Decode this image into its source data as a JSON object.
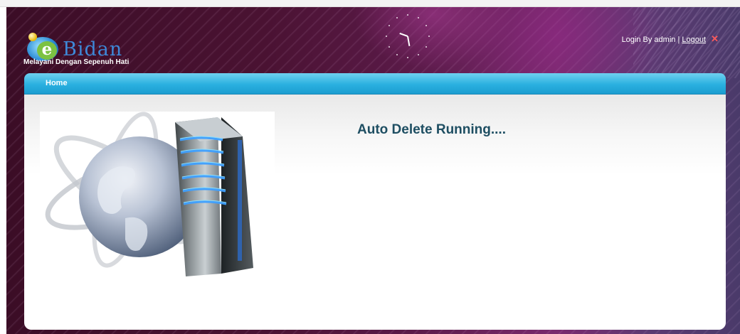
{
  "header": {
    "logo": {
      "letter": "e",
      "name": "Bidan",
      "tagline": "Melayani Dengan Sepenuh Hati"
    },
    "user": {
      "prefix": "Login By admin |",
      "logout_label": "Logout"
    },
    "icons": {
      "clock": "analog-clock-icon",
      "logout": "close-x-icon"
    }
  },
  "nav": {
    "items": [
      {
        "label": "Home"
      }
    ]
  },
  "main": {
    "status_text": "Auto Delete Running....",
    "illustration": "server-globe-illustration"
  },
  "colors": {
    "banner": "#4a1232",
    "nav_bar": "#2ab0e0",
    "status_text": "#1e4e62",
    "logout_x": "#ff5a5a"
  }
}
